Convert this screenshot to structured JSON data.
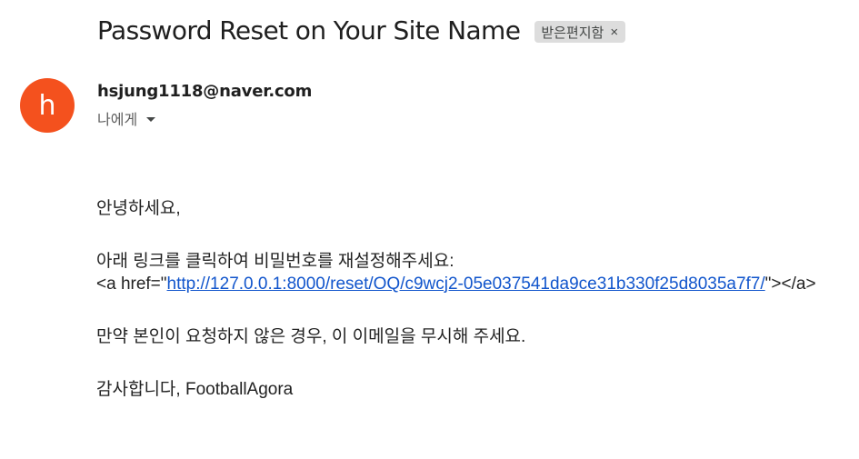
{
  "header": {
    "subject": "Password Reset on Your Site Name",
    "label": "받은편지함",
    "label_remove": "×"
  },
  "sender": {
    "avatar_letter": "h",
    "avatar_color": "#f4511e",
    "email": "hsjung1118@naver.com",
    "recipient": "나에게",
    "recipient_icon": "chevron-down-icon"
  },
  "body": {
    "greeting": "안녕하세요,",
    "instruction": "아래 링크를 클릭하여 비밀번호를 재설정해주세요:",
    "link_prefix": "<a href=\"",
    "link_url": "http://127.0.0.1:8000/reset/OQ/c9wcj2-05e037541da9ce31b330f25d8035a7f7/",
    "link_suffix": "\"></a>",
    "notice": "만약 본인이 요청하지 않은 경우, 이 이메일을 무시해 주세요.",
    "closing": "감사합니다, FootballAgora"
  },
  "colors": {
    "link": "#1155cc",
    "label_bg": "#dddddd"
  }
}
